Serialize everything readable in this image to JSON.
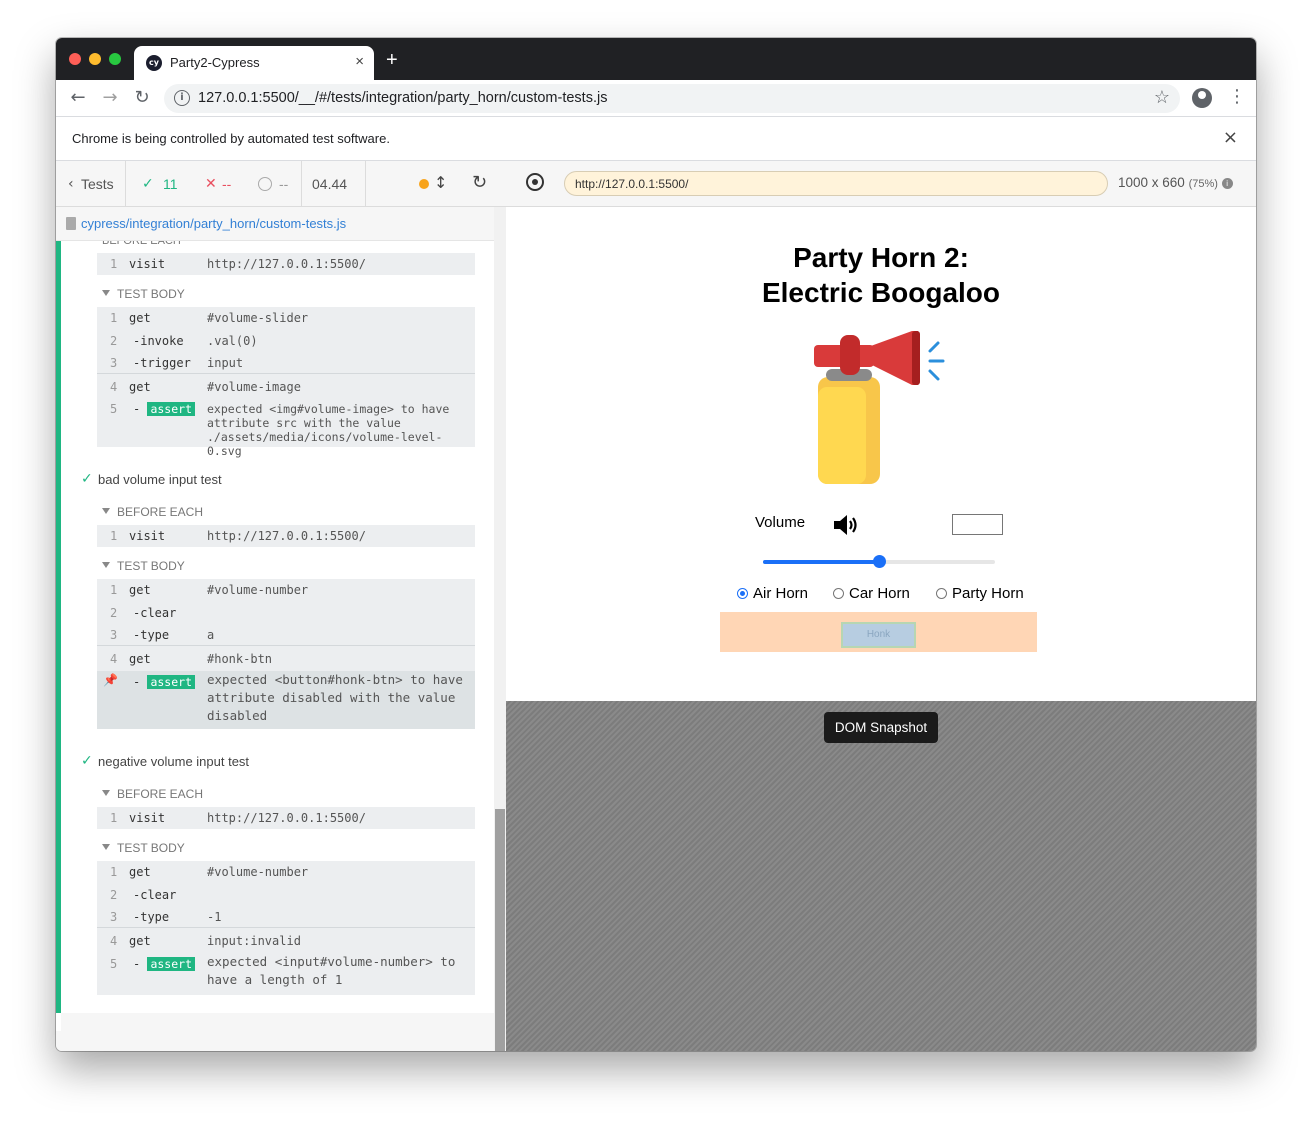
{
  "browser": {
    "tab_title": "Party2-Cypress",
    "favicon_text": "cy",
    "tab_close": "×",
    "new_tab": "+",
    "url": "127.0.0.1:5500/__/#/tests/integration/party_horn/custom-tests.js",
    "infobar_message": "Chrome is being controlled by automated test software.",
    "infobar_close": "×"
  },
  "reporter": {
    "tests_button": "Tests",
    "passed": "11",
    "failed": "--",
    "pending": "--",
    "duration": "04.44",
    "spec_path": "cypress/integration/party_horn/custom-tests.js",
    "sections": {
      "before_each": "BEFORE EACH",
      "test_body": "TEST BODY"
    },
    "tests": [
      {
        "title": "",
        "before_each": [
          {
            "num": "1",
            "name": "visit",
            "msg": "http://127.0.0.1:5500/"
          }
        ],
        "body": [
          {
            "num": "1",
            "name": "get",
            "msg": "#volume-slider"
          },
          {
            "num": "2",
            "name": "-invoke",
            "msg": ".val(0)"
          },
          {
            "num": "3",
            "name": "-trigger",
            "msg": "input"
          },
          {
            "num": "4",
            "name": "get",
            "msg": "#volume-image"
          },
          {
            "num": "5",
            "name": "assert",
            "msg": "expected <img#volume-image> to have attribute src with the value ./assets/media/icons/volume-level-0.svg"
          }
        ]
      },
      {
        "title": "bad volume input test",
        "before_each": [
          {
            "num": "1",
            "name": "visit",
            "msg": "http://127.0.0.1:5500/"
          }
        ],
        "body": [
          {
            "num": "1",
            "name": "get",
            "msg": "#volume-number"
          },
          {
            "num": "2",
            "name": "-clear",
            "msg": ""
          },
          {
            "num": "3",
            "name": "-type",
            "msg": "a"
          },
          {
            "num": "4",
            "name": "get",
            "msg": "#honk-btn"
          },
          {
            "num": "",
            "name": "assert",
            "msg": "expected <button#honk-btn> to have attribute disabled with the value disabled"
          }
        ]
      },
      {
        "title": "negative volume input test",
        "before_each": [
          {
            "num": "1",
            "name": "visit",
            "msg": "http://127.0.0.1:5500/"
          }
        ],
        "body": [
          {
            "num": "1",
            "name": "get",
            "msg": "#volume-number"
          },
          {
            "num": "2",
            "name": "-clear",
            "msg": ""
          },
          {
            "num": "3",
            "name": "-type",
            "msg": "-1"
          },
          {
            "num": "4",
            "name": "get",
            "msg": "input:invalid"
          },
          {
            "num": "5",
            "name": "assert",
            "msg": "expected <input#volume-number> to have a length of 1"
          }
        ]
      }
    ]
  },
  "aut": {
    "url": "http://127.0.0.1:5500/",
    "viewport": "1000 x 660",
    "scale": "(75%)",
    "info_glyph": "i",
    "snapshot_label": "DOM Snapshot",
    "app": {
      "title_line1": "Party Horn 2:",
      "title_line2": "Electric Boogaloo",
      "volume_label": "Volume",
      "volume_level": 0.5,
      "radios": [
        {
          "label": "Air Horn",
          "checked": true
        },
        {
          "label": "Car Horn",
          "checked": false
        },
        {
          "label": "Party Horn",
          "checked": false
        }
      ],
      "honk_label": "Honk"
    }
  },
  "colors": {
    "pass_green": "#1fb682",
    "fail_red": "#e94f5f",
    "pending_orange": "#f8a41c",
    "link_blue": "#3380d5"
  }
}
